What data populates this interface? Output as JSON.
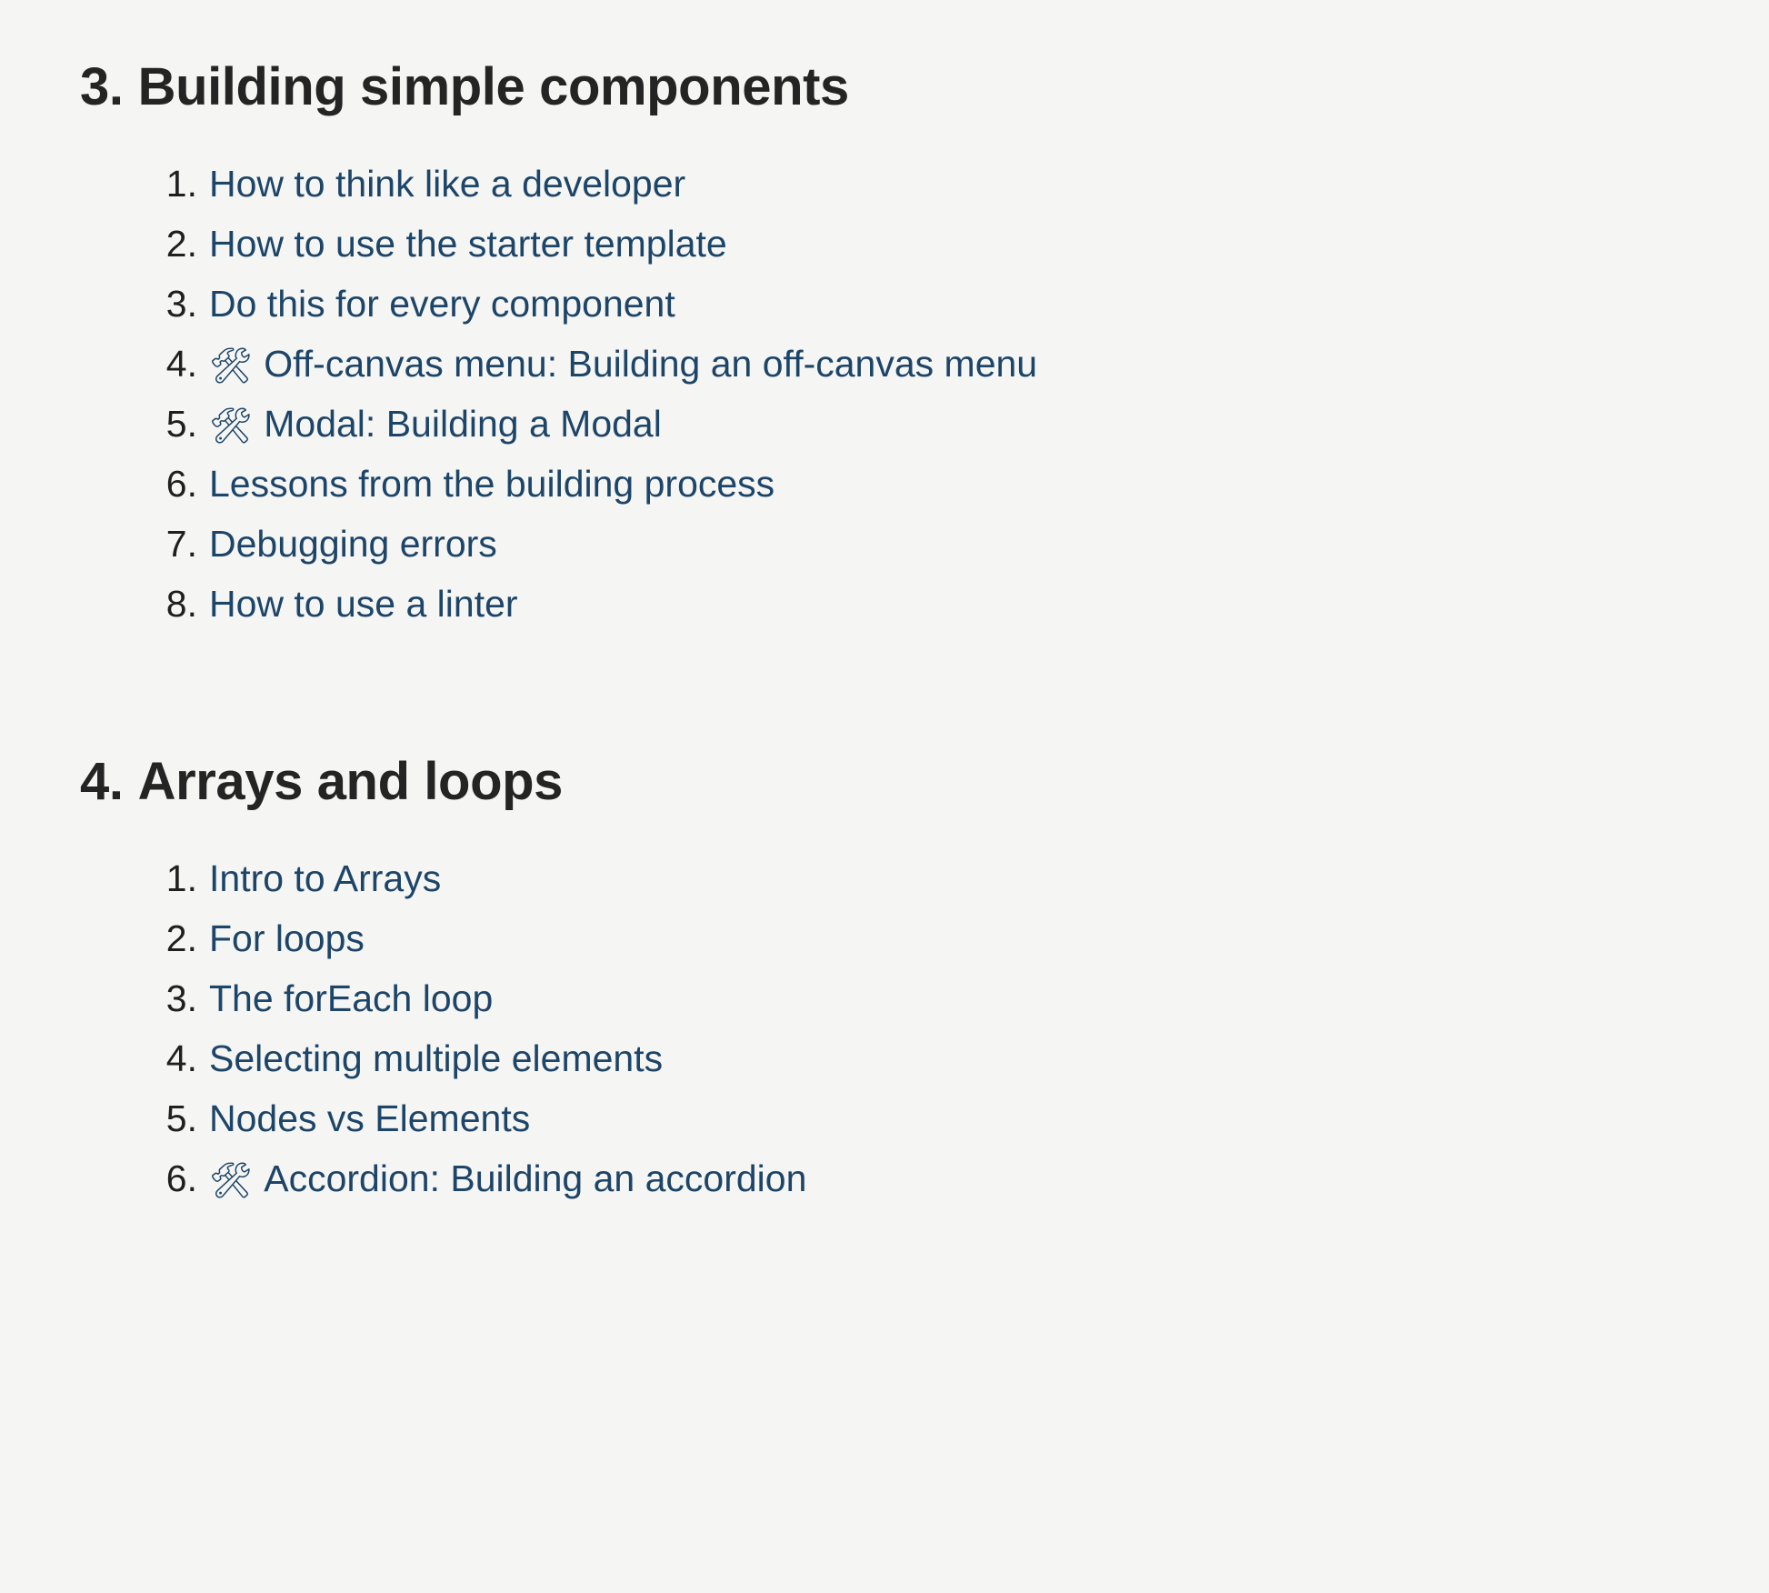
{
  "page": {
    "background_color": "#f5f5f4",
    "heading_color": "#242424",
    "link_color": "#1d4568",
    "number_color": "#1f1f1f"
  },
  "sections": [
    {
      "id": "building-simple-components",
      "number": "3.",
      "title": "Building simple components",
      "items": [
        {
          "number": "1.",
          "emoji": "",
          "emoji_name": "",
          "label": "How to think like a developer"
        },
        {
          "number": "2.",
          "emoji": "",
          "emoji_name": "",
          "label": "How to use the starter template"
        },
        {
          "number": "3.",
          "emoji": "",
          "emoji_name": "",
          "label": "Do this for every component"
        },
        {
          "number": "4.",
          "emoji": "🛠",
          "emoji_name": "hammer-and-wrench-icon",
          "label": "Off-canvas menu: Building an off-canvas menu"
        },
        {
          "number": "5.",
          "emoji": "🛠",
          "emoji_name": "hammer-and-wrench-icon",
          "label": "Modal: Building a Modal"
        },
        {
          "number": "6.",
          "emoji": "",
          "emoji_name": "",
          "label": "Lessons from the building process"
        },
        {
          "number": "7.",
          "emoji": "",
          "emoji_name": "",
          "label": "Debugging errors"
        },
        {
          "number": "8.",
          "emoji": "",
          "emoji_name": "",
          "label": "How to use a linter"
        }
      ]
    },
    {
      "id": "arrays-and-loops",
      "number": "4.",
      "title": "Arrays and loops",
      "items": [
        {
          "number": "1.",
          "emoji": "",
          "emoji_name": "",
          "label": "Intro to Arrays"
        },
        {
          "number": "2.",
          "emoji": "",
          "emoji_name": "",
          "label": "For loops"
        },
        {
          "number": "3.",
          "emoji": "",
          "emoji_name": "",
          "label": "The forEach loop"
        },
        {
          "number": "4.",
          "emoji": "",
          "emoji_name": "",
          "label": "Selecting multiple elements"
        },
        {
          "number": "5.",
          "emoji": "",
          "emoji_name": "",
          "label": "Nodes vs Elements"
        },
        {
          "number": "6.",
          "emoji": "🛠",
          "emoji_name": "hammer-and-wrench-icon",
          "label": "Accordion: Building an accordion"
        }
      ]
    }
  ]
}
